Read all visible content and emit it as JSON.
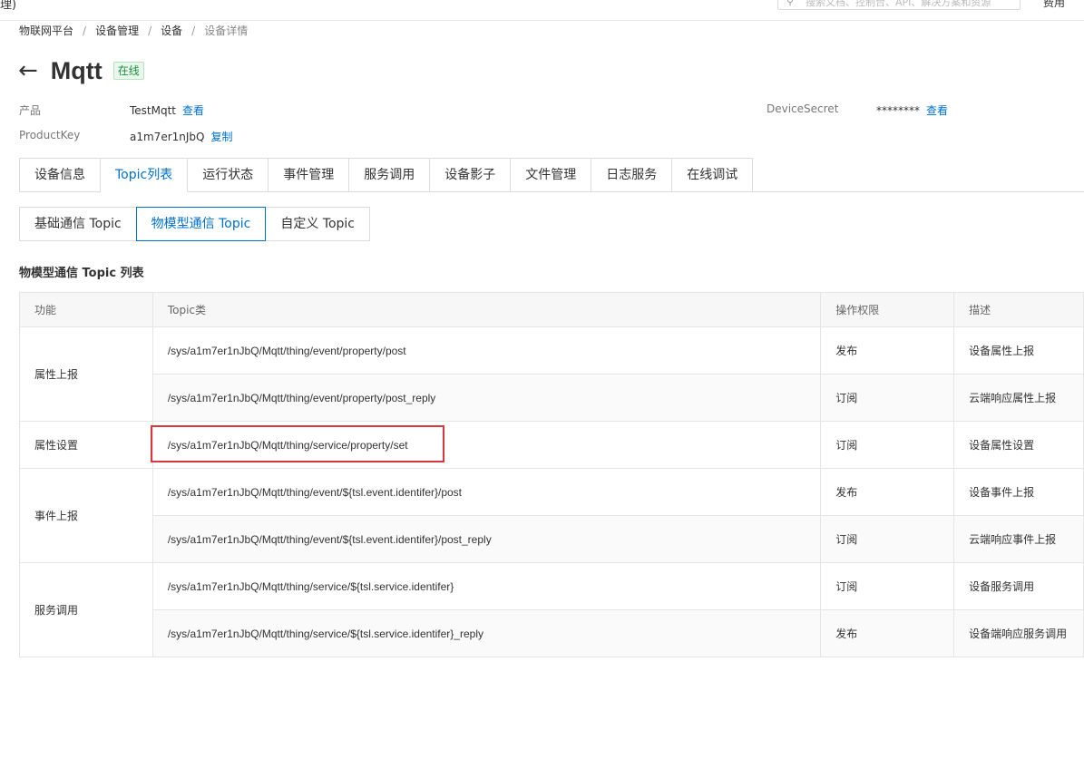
{
  "topbar": {
    "left_cut": "理)",
    "search_placeholder": "搜索文档、控制台、API、解决方案和资源",
    "right_cut": "费用"
  },
  "breadcrumb": [
    "物联网平台",
    "设备管理",
    "设备",
    "设备详情"
  ],
  "device": {
    "name": "Mqtt",
    "status": "在线"
  },
  "info": {
    "product_label": "产品",
    "product_value": "TestMqtt",
    "product_link": "查看",
    "productkey_label": "ProductKey",
    "productkey_value": "a1m7er1nJbQ",
    "productkey_link": "复制",
    "secret_label": "DeviceSecret",
    "secret_value": "********",
    "secret_link": "查看"
  },
  "tabs": [
    "设备信息",
    "Topic列表",
    "运行状态",
    "事件管理",
    "服务调用",
    "设备影子",
    "文件管理",
    "日志服务",
    "在线调试"
  ],
  "active_tab": 1,
  "subtabs": [
    "基础通信 Topic",
    "物模型通信 Topic",
    "自定义 Topic"
  ],
  "active_subtab": 1,
  "section_title": "物模型通信 Topic 列表",
  "table": {
    "headers": [
      "功能",
      "Topic类",
      "操作权限",
      "描述"
    ],
    "rows": [
      {
        "func": "属性上报",
        "topic": "/sys/a1m7er1nJbQ/Mqtt/thing/event/property/post",
        "perm": "发布",
        "desc": "设备属性上报"
      },
      {
        "func": "",
        "topic": "/sys/a1m7er1nJbQ/Mqtt/thing/event/property/post_reply",
        "perm": "订阅",
        "desc": "云端响应属性上报"
      },
      {
        "func": "属性设置",
        "topic": "/sys/a1m7er1nJbQ/Mqtt/thing/service/property/set",
        "perm": "订阅",
        "desc": "设备属性设置"
      },
      {
        "func": "事件上报",
        "topic": "/sys/a1m7er1nJbQ/Mqtt/thing/event/${tsl.event.identifer}/post",
        "perm": "发布",
        "desc": "设备事件上报"
      },
      {
        "func": "",
        "topic": "/sys/a1m7er1nJbQ/Mqtt/thing/event/${tsl.event.identifer}/post_reply",
        "perm": "订阅",
        "desc": "云端响应事件上报"
      },
      {
        "func": "服务调用",
        "topic": "/sys/a1m7er1nJbQ/Mqtt/thing/service/${tsl.service.identifer}",
        "perm": "订阅",
        "desc": "设备服务调用"
      },
      {
        "func": "",
        "topic": "/sys/a1m7er1nJbQ/Mqtt/thing/service/${tsl.service.identifer}_reply",
        "perm": "发布",
        "desc": "设备端响应服务调用"
      }
    ]
  },
  "colors": {
    "accent": "#0070cc",
    "online": "#1e8e3e",
    "highlight": "#d9363e"
  }
}
